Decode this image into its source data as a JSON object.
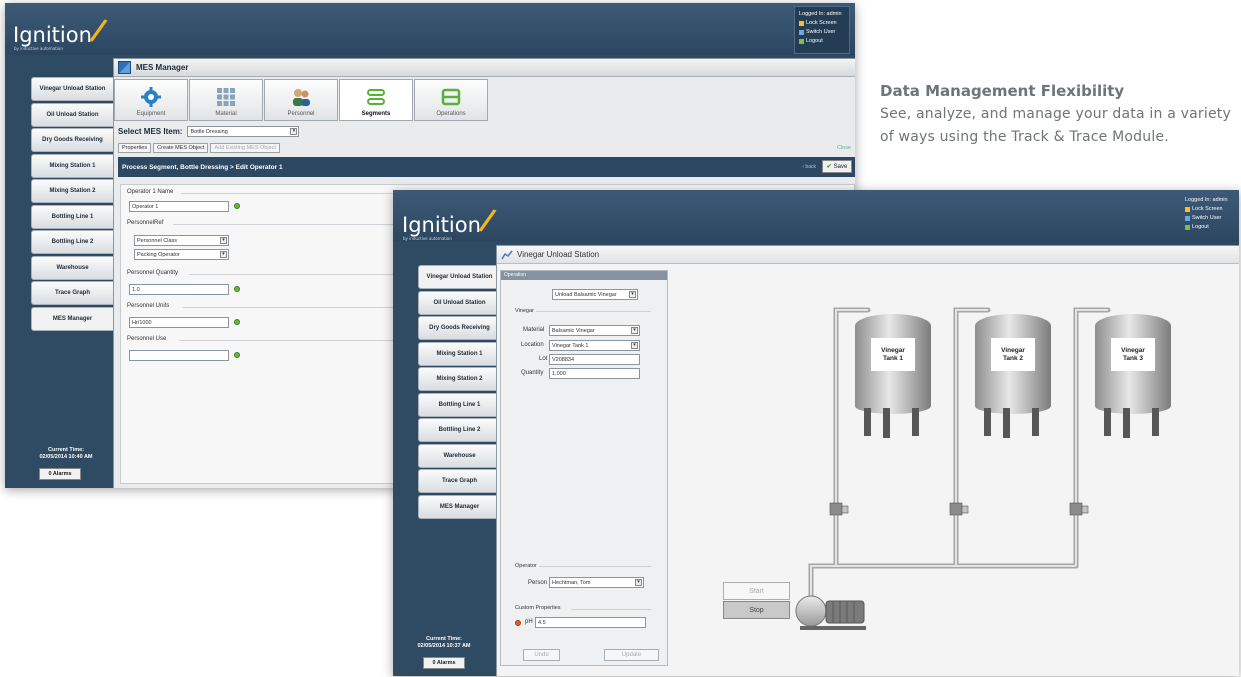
{
  "caption": {
    "title": "Data Management Flexibility",
    "line1": "See, analyze, and manage your data in a variety",
    "line2": "of ways using the Track & Trace Module."
  },
  "logo": {
    "text": "Ignition",
    "subtext": "by inductive automation"
  },
  "login": {
    "logged_in": "Logged In: admin",
    "lock": "Lock Screen",
    "switch": "Switch User",
    "logout": "Logout"
  },
  "nav_items": [
    "Vinegar Unload Station",
    "Oil Unload Station",
    "Dry Goods Receiving",
    "Mixing Station 1",
    "Mixing Station 2",
    "Bottling Line 1",
    "Bottling Line 2",
    "Warehouse",
    "Trace Graph",
    "MES Manager"
  ],
  "window1": {
    "title": "MES Manager",
    "tabs": [
      "Equipment",
      "Material",
      "Personnel",
      "Segments",
      "Operations"
    ],
    "select_label": "Select MES Item:",
    "select_value": "Bottle Dressing",
    "subtabs": [
      "Properties",
      "Create MES Object",
      "Add Existing MES Object"
    ],
    "close": "Close",
    "header": "Process Segment, Bottle Dressing > Edit Operator 1",
    "back": "‹ back",
    "save": "Save",
    "operator_name_label": "Operator 1 Name",
    "operator_name_value": "Operator 1",
    "personnel_ref_label": "PersonnelRef",
    "personnel_class": "Personnel Class",
    "packing_operator": "Packing Operator",
    "quantity_label": "Personnel Quantity",
    "quantity_value": "1.0",
    "units_label": "Personnel Units",
    "units_value": "Hr/1000",
    "use_label": "Personnel Use",
    "use_value": "",
    "time_label": "Current Time:",
    "time_value": "02/05/2014 10:40 AM",
    "alarms": "0 Alarms"
  },
  "window2": {
    "title": "Vinegar Unload Station",
    "operation_header": "Operation",
    "operation_value": "Unload Balsamic Vinegar",
    "vinegar_section": "Vinegar",
    "material_label": "Material",
    "material_value": "Balsamic Vinegar",
    "location_label": "Location",
    "location_value": "Vinegar Tank 1",
    "lot_label": "Lot",
    "lot_value": "V208834",
    "quantity_label": "Quantity",
    "quantity_value": "1,000",
    "operator_section": "Operator",
    "person_label": "Person",
    "person_value": "Hechtman, Tom",
    "custom_section": "Custom Properties",
    "ph_label": "pH",
    "ph_value": "4.5",
    "undo": "Undo",
    "update": "Update",
    "start": "Start",
    "stop": "Stop",
    "tanks": [
      {
        "line1": "Vinegar",
        "line2": "Tank 1"
      },
      {
        "line1": "Vinegar",
        "line2": "Tank 2"
      },
      {
        "line1": "Vinegar",
        "line2": "Tank 3"
      }
    ],
    "time_label": "Current Time:",
    "time_value": "02/05/2014 10:37 AM",
    "alarms": "0 Alarms"
  },
  "colors": {
    "frame_dark": "#2f4a63",
    "accent_yellow": "#f7b41c",
    "status_green": "#6bb73a",
    "ph_red": "#e05c2b"
  }
}
